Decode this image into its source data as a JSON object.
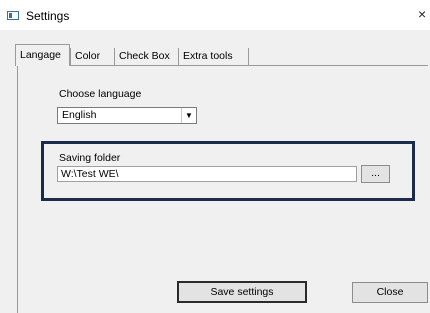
{
  "window": {
    "title": "Settings",
    "close_glyph": "×"
  },
  "tabs": [
    {
      "label": "Langage",
      "active": true
    },
    {
      "label": "Color",
      "active": false
    },
    {
      "label": "Check Box",
      "active": false
    },
    {
      "label": "Extra tools",
      "active": false
    }
  ],
  "language": {
    "label": "Choose language",
    "selected": "English",
    "arrow_glyph": "▼"
  },
  "saving_folder": {
    "label": "Saving folder",
    "path": "W:\\Test WE\\",
    "browse_label": "..."
  },
  "actions": {
    "save_label": "Save settings",
    "close_label": "Close"
  },
  "colors": {
    "highlight_frame": "#1b2b4d",
    "window_background": "#f0f0f0"
  }
}
